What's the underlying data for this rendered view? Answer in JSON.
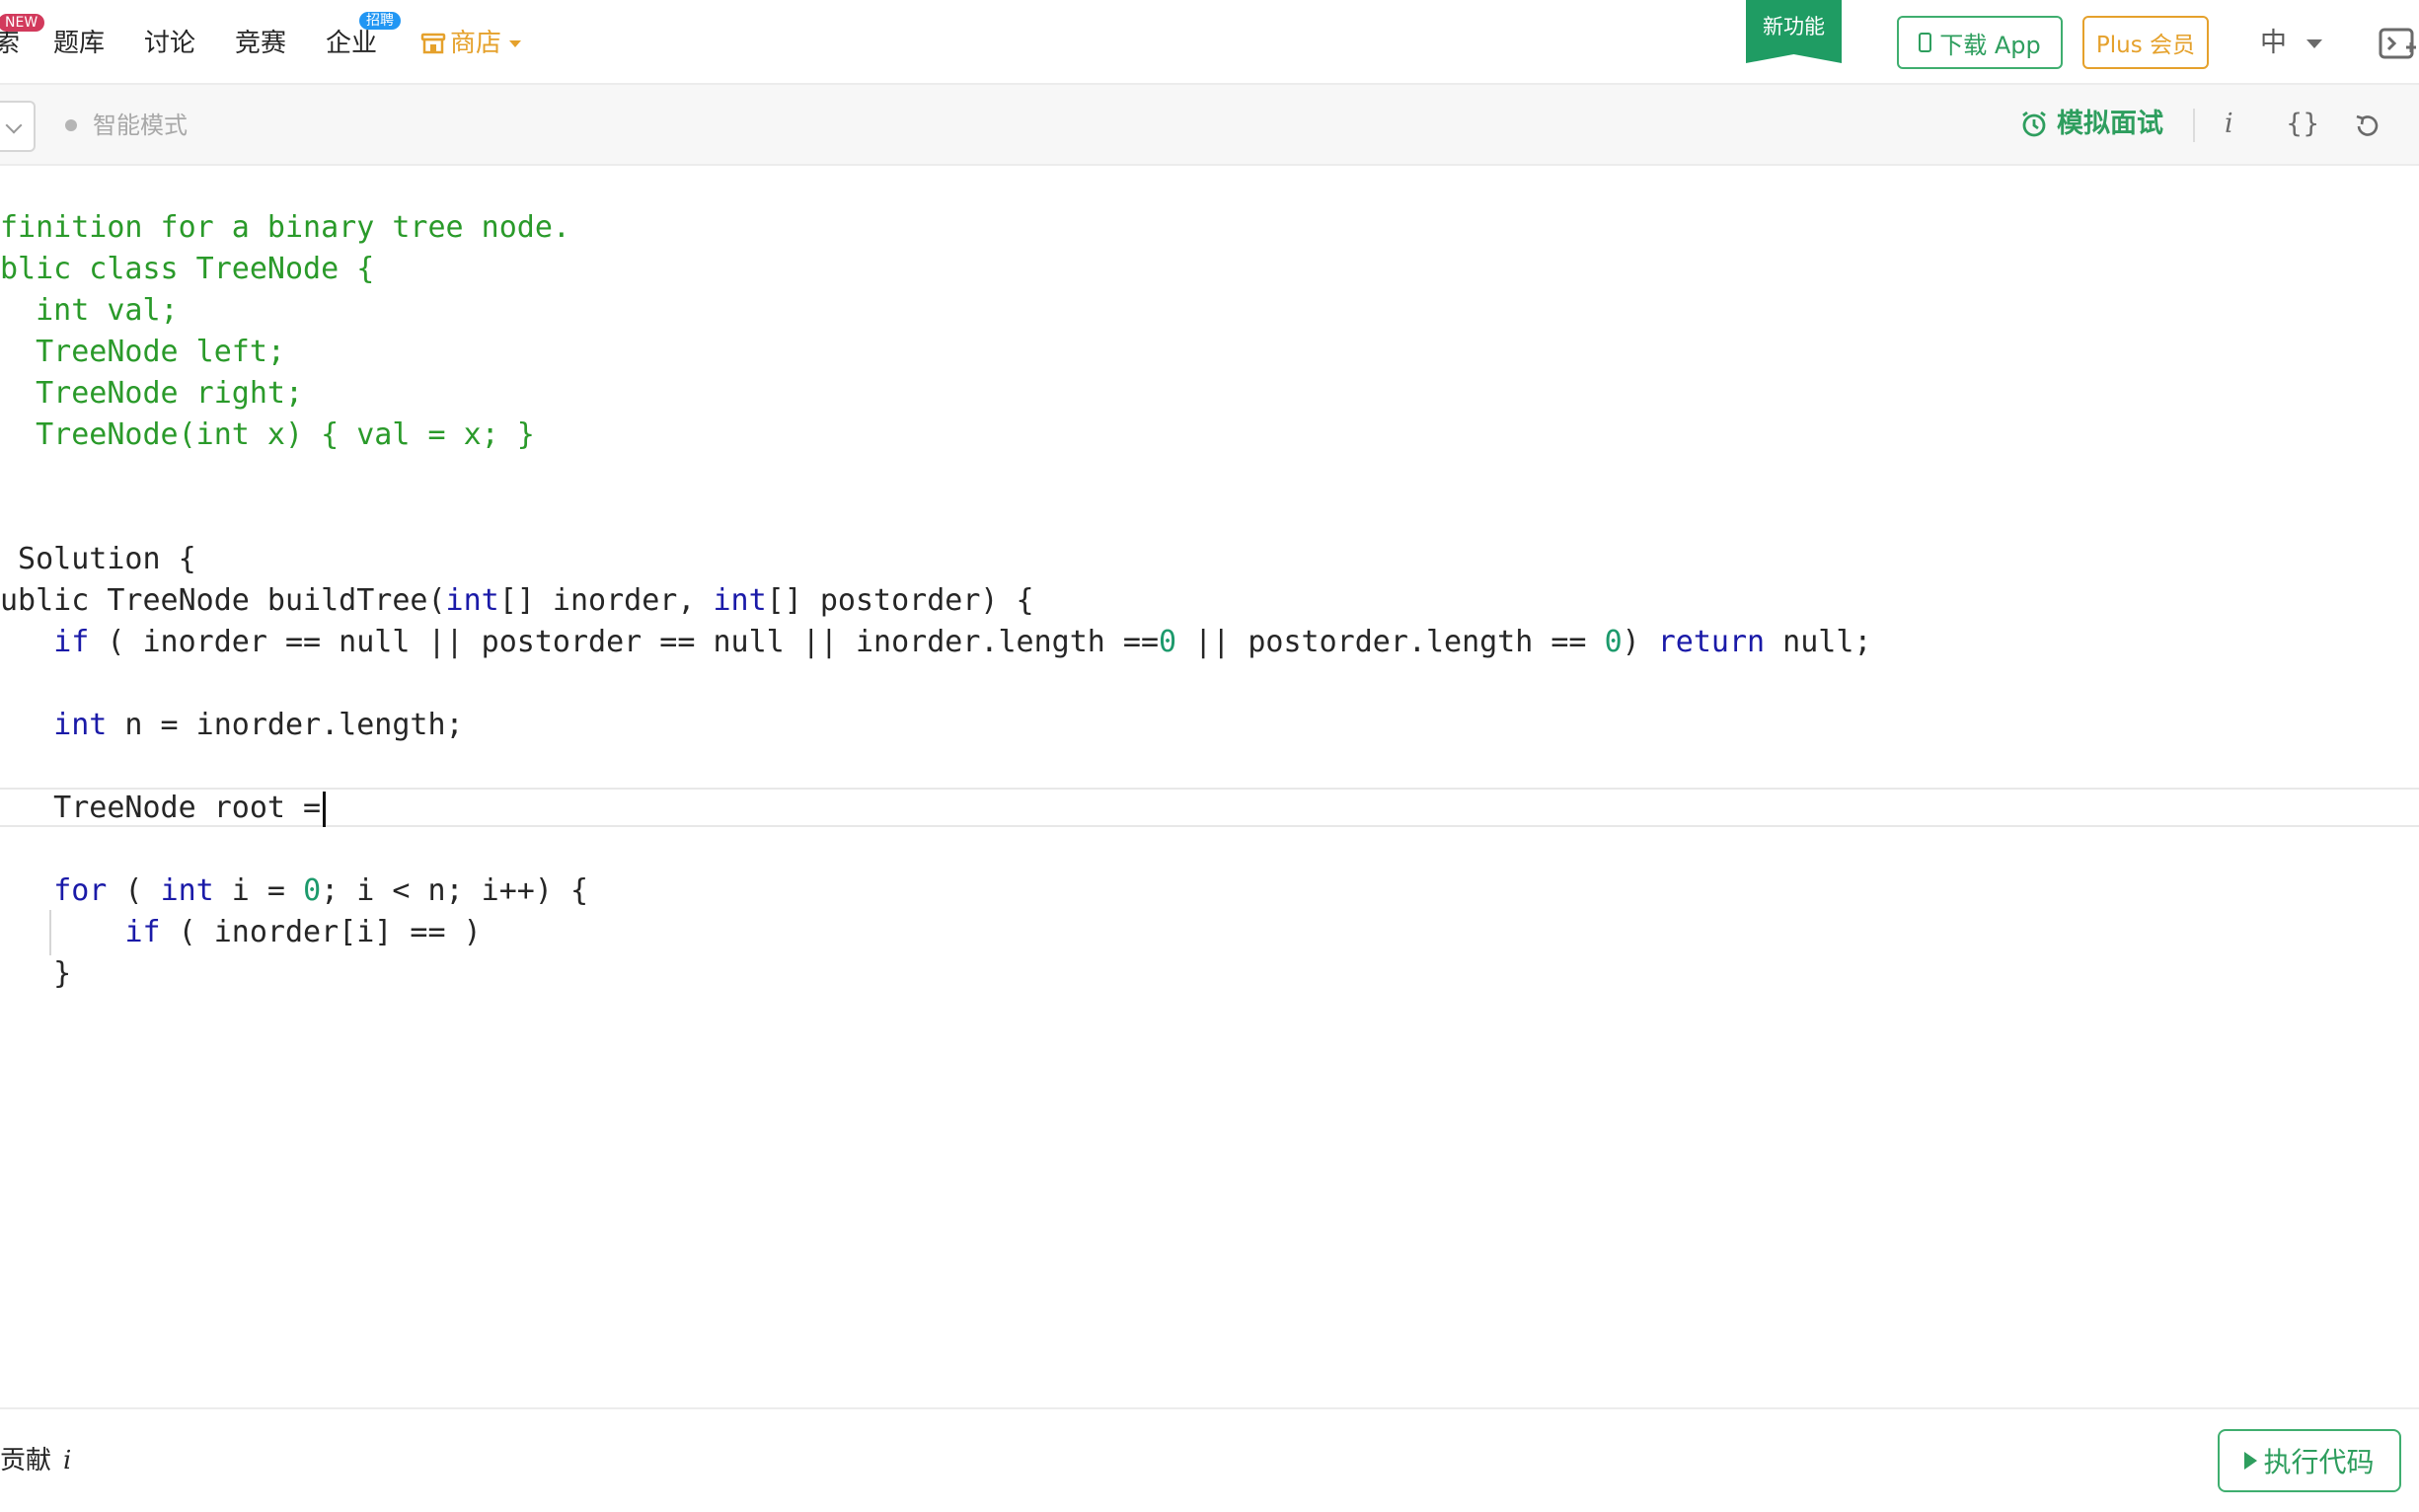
{
  "nav": {
    "partial_item": "索",
    "new_badge": "NEW",
    "items": [
      "题库",
      "讨论",
      "竞赛",
      "企业"
    ],
    "hire_badge": "招聘",
    "shop": "商店",
    "feature_ribbon": "新功能",
    "download_app": "下载 App",
    "plus_member": "Plus 会员",
    "language": "中"
  },
  "toolbar": {
    "smart_mode": "智能模式",
    "mock_interview": "模拟面试",
    "info_icon": "i",
    "format_icon": "{}"
  },
  "code_lines": [
    "finition for a binary tree node.",
    "blic class TreeNode {",
    "  int val;",
    "  TreeNode left;",
    "  TreeNode right;",
    "  TreeNode(int x) { val = x; }",
    " Solution {",
    "ublic TreeNode buildTree(int[] inorder, int[] postorder) {",
    "   if ( inorder == null || postorder == null || inorder.length ==0 || postorder.length == 0) return null;",
    "   int n = inorder.length;",
    "   TreeNode root =",
    "   for ( int i = 0; i < n; i++) {",
    "       if ( inorder[i] == )",
    "   }"
  ],
  "bottom": {
    "contribute": "贡献",
    "contribute_info": "i",
    "run_code": "执行代码"
  },
  "colors": {
    "accent_green": "#2e9e5e",
    "orange": "#e5a12c",
    "comment": "#2a9a2a",
    "keyword": "#1a1aa8",
    "number": "#1d9a6c"
  }
}
